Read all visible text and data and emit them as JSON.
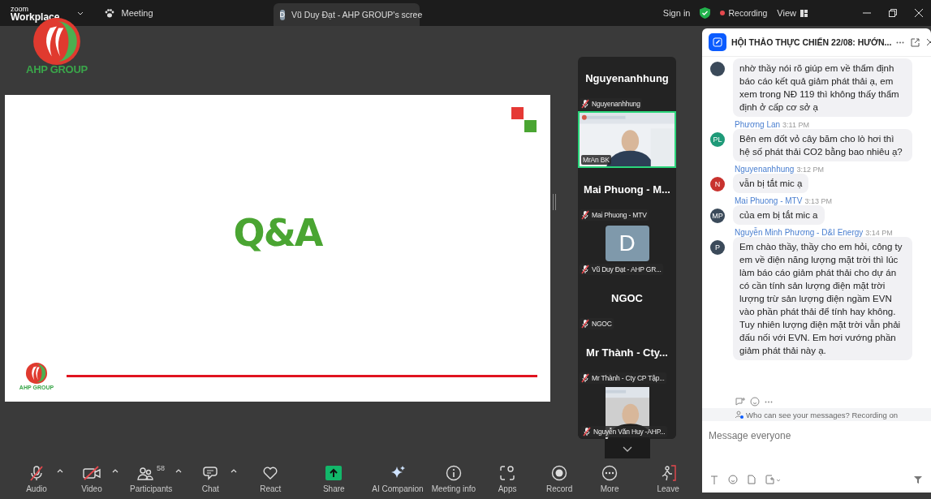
{
  "top_bar": {
    "logo_line1": "zoom",
    "logo_line2": "Workplace",
    "meeting_label": "Meeting",
    "share_tab": {
      "avatar": "D",
      "title": "Vũ Duy Đạt - AHP GROUP's scree"
    },
    "sign_in": "Sign in",
    "recording": {
      "label": "Recording",
      "on": true
    },
    "view": "View"
  },
  "overlay_logo": {
    "text": "AHP GROUP"
  },
  "slide": {
    "title": "Q&A",
    "logo_text": "AHP GROUP"
  },
  "gallery": {
    "tiles": [
      {
        "kind": "name",
        "title": "Nguyenanhhung",
        "label": "Nguyenanhhung",
        "muted": true
      },
      {
        "kind": "video",
        "label": "MrAn BK",
        "muted": false,
        "speaking": true
      },
      {
        "kind": "name",
        "title": "Mai Phuong - M...",
        "label": "Mai Phuong - MTV",
        "muted": true
      },
      {
        "kind": "avatar",
        "initial": "D",
        "label": "Vũ Duy Đạt - AHP GR...",
        "muted": true
      },
      {
        "kind": "name",
        "title": "NGOC",
        "label": "NGOC",
        "muted": true
      },
      {
        "kind": "name",
        "title": "Mr Thành - Cty...",
        "label": "Mr Thành - Cty CP Tập...",
        "muted": true
      },
      {
        "kind": "video",
        "label": "Nguyễn Văn Huy -AHP...",
        "muted": true,
        "speaking": false
      }
    ]
  },
  "chat": {
    "title": "HỘI THẢO THỰC CHIẾN 22/08: HƯỚN...",
    "messages": [
      {
        "color": "#3b4a5a",
        "text": "nhờ thầy nói rõ giúp em về thẩm định báo cáo kết quả giảm phát thải ạ, em xem trong NĐ 119 thì không thấy thẩm định ở cấp cơ sở ạ"
      },
      {
        "sender": "Phương Lan",
        "time": "3:11 PM",
        "initials": "PL",
        "color": "#1e9a78",
        "text": "Bên em đốt vỏ cây băm cho lò hơi thì hệ số phát thải CO2 bằng bao nhiêu ạ?"
      },
      {
        "sender": "Nguyenanhhung",
        "time": "3:12 PM",
        "initials": "N",
        "color": "#c8322e",
        "text": "vẫn bị tắt mic ạ"
      },
      {
        "sender": "Mai Phuong - MTV",
        "time": "3:13 PM",
        "initials": "MP",
        "color": "#3b4a5a",
        "text": "của em bị tắt mic a"
      },
      {
        "sender": "Nguyễn Minh Phương - D&I Energy",
        "time": "3:14 PM",
        "initials": "P",
        "color": "#3b4a5a",
        "text": "Em chào thầy, thầy cho em hỏi, công ty em về điện năng lượng mặt trời thì lúc làm báo cáo giảm phát thải cho dự án có cần tính sản lượng điện mặt trời lượng trừ sản lượng điện ngầm EVN vào phần phát thải để tính hay không. Tuy nhiên lượng điện mặt trời vẫn phải đấu nối với EVN. Em hơi vướng phần giảm phát thải này ạ."
      }
    ],
    "notice": "Who can see your messages? Recording on",
    "placeholder": "Message everyone"
  },
  "toolbar": {
    "items": [
      {
        "kind": "audio",
        "label": "Audio",
        "muted": true,
        "caret": true
      },
      {
        "kind": "video",
        "label": "Video",
        "muted": true,
        "caret": true
      },
      {
        "kind": "participants",
        "label": "Participants",
        "count": "58",
        "caret": true
      },
      {
        "kind": "chat",
        "label": "Chat",
        "caret": true
      },
      {
        "kind": "react",
        "label": "React"
      },
      {
        "kind": "share",
        "label": "Share"
      },
      {
        "kind": "ai",
        "label": "AI Companion"
      },
      {
        "kind": "info",
        "label": "Meeting info"
      },
      {
        "kind": "apps",
        "label": "Apps"
      },
      {
        "kind": "record",
        "label": "Record"
      },
      {
        "kind": "more",
        "label": "More"
      },
      {
        "kind": "leave",
        "label": "Leave"
      }
    ]
  }
}
